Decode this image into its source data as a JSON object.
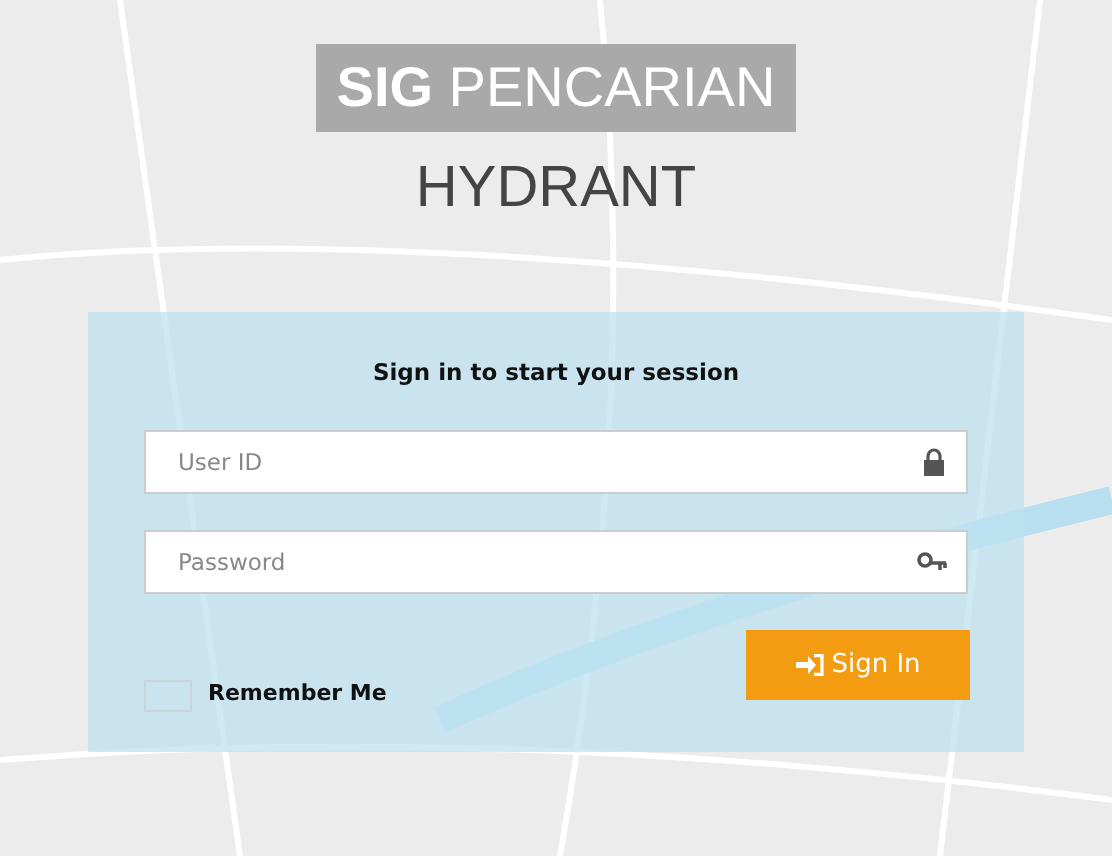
{
  "title": {
    "bold": "SIG",
    "light": "PENCARIAN",
    "subtitle": "HYDRANT"
  },
  "login": {
    "heading": "Sign in to start your session",
    "fields": [
      {
        "placeholder": "User ID",
        "kind": "lock"
      },
      {
        "placeholder": "Password",
        "kind": "key"
      }
    ],
    "remember": {
      "label": "Remember Me",
      "checked": false
    },
    "button": {
      "label": "Sign In"
    }
  }
}
